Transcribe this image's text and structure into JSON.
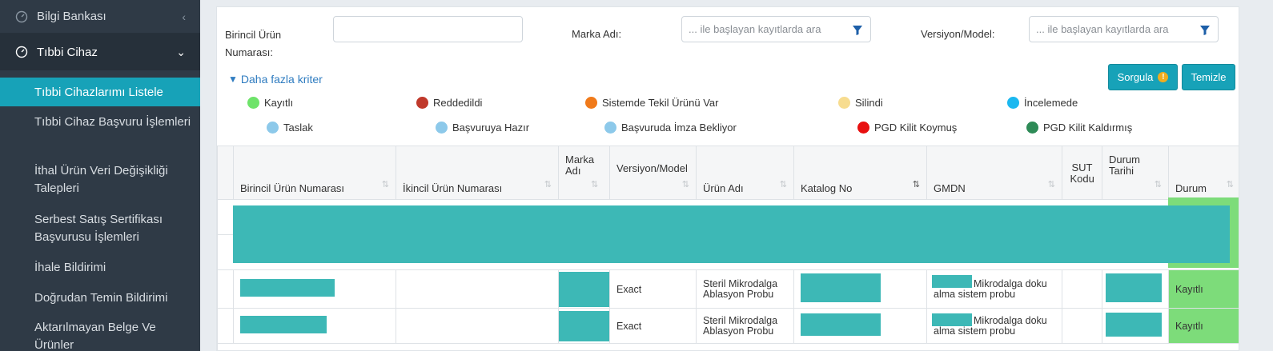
{
  "sidebar": {
    "top_item": "Bilgi Bankası",
    "group": "Tıbbi Cihaz",
    "active_item": "Tıbbi Cihazlarımı Listele",
    "items": [
      "Tıbbi Cihaz Başvuru İşlemleri",
      "İthal Ürün Veri Değişikliği Talepleri",
      "Serbest Satış Sertifikası Başvurusu İşlemleri",
      "İhale Bildirimi",
      "Doğrudan Temin Bildirimi",
      "Aktarılmayan Belge Ve Ürünler"
    ]
  },
  "filters": {
    "birincil_label": "Birincil Ürün Numarası:",
    "birincil_value": "",
    "marka_label": "Marka Adı:",
    "marka_placeholder": "... ile başlayan kayıtlarda ara",
    "versiyon_label": "Versiyon/Model:",
    "versiyon_placeholder": "... ile başlayan kayıtlarda ara",
    "more_label": "Daha fazla kriter",
    "search_button": "Sorgula",
    "clear_button": "Temizle"
  },
  "legend": [
    {
      "label": "Kayıtlı",
      "color": "#6ee36a"
    },
    {
      "label": "Reddedildi",
      "color": "#c0392b"
    },
    {
      "label": "Sistemde Tekil Ürünü Var",
      "color": "#f07a1a"
    },
    {
      "label": "Silindi",
      "color": "#f7dc8f"
    },
    {
      "label": "İncelemede",
      "color": "#1bb8f0"
    },
    {
      "label": "Taslak",
      "color": "#8dc9ea"
    },
    {
      "label": "Başvuruya Hazır",
      "color": "#8dc9ea"
    },
    {
      "label": "Başvuruda İmza Bekliyor",
      "color": "#8dc9ea"
    },
    {
      "label": "PGD Kilit Koymuş",
      "color": "#e81010"
    },
    {
      "label": "PGD Kilit Kaldırmış",
      "color": "#2e8b57"
    }
  ],
  "table": {
    "headers": [
      "Birincil Ürün Numarası",
      "İkincil Ürün Numarası",
      "Marka Adı",
      "Versiyon/Model",
      "Ürün Adı",
      "Katalog No",
      "GMDN",
      "SUT Kodu",
      "Durum Tarihi",
      "Durum"
    ],
    "rows": [
      {
        "versiyon": "Exact",
        "urun_adi": "Steril Mikrodalga Ablasyon Probu",
        "gmdn": "Mikrodalga doku alma sistem probu",
        "durum": "Kayıtlı"
      },
      {
        "versiyon": "Exact",
        "urun_adi": "Steril Mikrodalga Ablasyon Probu",
        "gmdn": "Mikrodalga doku alma sistem probu",
        "durum": "Kayıtlı"
      }
    ]
  },
  "colors": {
    "accent": "#17a2b8",
    "sidebar": "#2f3a46",
    "redaction": "#3db8b6",
    "status_green": "#7ddc7a"
  }
}
